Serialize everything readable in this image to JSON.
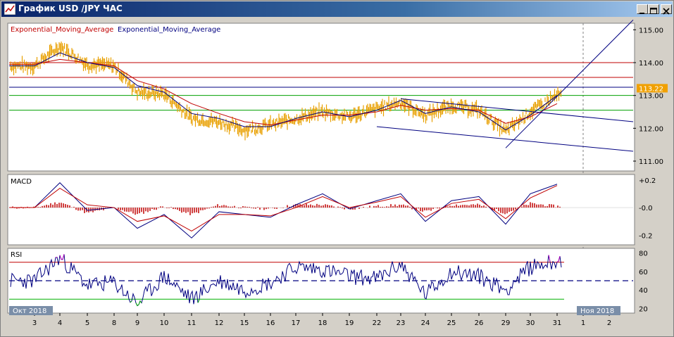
{
  "window": {
    "title": "График USD /JPY  ЧАС",
    "buttons": [
      "minimize",
      "maximize",
      "close"
    ],
    "icons": {
      "app": "chart-icon",
      "minimize": "minimize-icon",
      "maximize": "maximize-icon",
      "close": "close-icon"
    }
  },
  "colors": {
    "background": "#ffffff",
    "frame": "#d4d0c8",
    "price": "#e8a000",
    "ema_red": "#c00000",
    "ema_navy": "#000080",
    "line_level_red": "#c00000",
    "line_level_green": "#00a000",
    "current_price_bg": "#f0a000",
    "macd_hist": "#c00000",
    "rsi_line": "#000080",
    "rsi_overbought": "#c000c0",
    "rsi_oversold": "#00b000"
  },
  "legend": {
    "ema1": "Exponential_Moving_Average",
    "ema2": "Exponential_Moving_Average"
  },
  "price_axis": {
    "ticks": [
      "115.00",
      "114.00",
      "113.00",
      "112.00",
      "111.00"
    ],
    "current": "113.22"
  },
  "macd": {
    "label": "MACD",
    "ticks": [
      "+0.2",
      "-0.0",
      "-0.2"
    ]
  },
  "rsi": {
    "label": "RSI",
    "ticks": [
      "80",
      "60",
      "40",
      "20"
    ]
  },
  "time_axis": {
    "month_left": "Окт 2018",
    "month_right": "Ноя 2018",
    "days": [
      "3",
      "4",
      "5",
      "8",
      "9",
      "10",
      "11",
      "12",
      "15",
      "16",
      "17",
      "18",
      "19",
      "22",
      "23",
      "24",
      "25",
      "26",
      "29",
      "30",
      "31",
      "1",
      "2"
    ]
  },
  "chart_data": {
    "type": "line",
    "title": "График USD /JPY  ЧАС",
    "x": [
      "3",
      "4",
      "5",
      "8",
      "9",
      "10",
      "11",
      "12",
      "15",
      "16",
      "17",
      "18",
      "19",
      "22",
      "23",
      "24",
      "25",
      "26",
      "29",
      "30",
      "31",
      "1",
      "2"
    ],
    "ylim": [
      110.7,
      115.2
    ],
    "series": [
      {
        "name": "USD/JPY",
        "values": [
          113.9,
          114.5,
          113.95,
          113.9,
          113.1,
          113.05,
          112.3,
          112.2,
          111.95,
          112.1,
          112.3,
          112.5,
          112.35,
          112.6,
          112.8,
          112.4,
          112.7,
          112.55,
          111.9,
          112.5,
          113.0,
          null,
          null
        ]
      },
      {
        "name": "Exponential_Moving_Average",
        "values": [
          113.95,
          114.1,
          114.0,
          113.9,
          113.45,
          113.2,
          112.75,
          112.45,
          112.2,
          112.1,
          112.25,
          112.4,
          112.4,
          112.5,
          112.7,
          112.55,
          112.6,
          112.55,
          112.15,
          112.35,
          112.75,
          null,
          null
        ]
      },
      {
        "name": "Exponential_Moving_Average",
        "values": [
          113.9,
          114.3,
          114.0,
          113.85,
          113.3,
          113.1,
          112.45,
          112.3,
          112.05,
          112.05,
          112.3,
          112.5,
          112.35,
          112.55,
          112.85,
          112.45,
          112.65,
          112.5,
          111.95,
          112.4,
          113.0,
          null,
          null
        ]
      }
    ],
    "levels": [
      114.0,
      113.55,
      113.25,
      113.0,
      112.55
    ],
    "trendlines": [
      {
        "from": [
          "29",
          111.4
        ],
        "to": [
          "2",
          115.3
        ]
      },
      {
        "from": [
          "23",
          112.9
        ],
        "to": [
          "2",
          112.2
        ]
      },
      {
        "from": [
          "22",
          112.05
        ],
        "to": [
          "2",
          111.3
        ]
      }
    ],
    "macd": {
      "ylim": [
        -0.27,
        0.24
      ],
      "line": [
        0.0,
        0.18,
        -0.02,
        0.0,
        -0.15,
        -0.05,
        -0.22,
        -0.03,
        -0.05,
        -0.07,
        0.02,
        0.1,
        -0.01,
        0.05,
        0.1,
        -0.1,
        0.05,
        0.08,
        -0.12,
        0.1,
        0.17,
        null,
        null
      ],
      "signal": [
        0.0,
        0.14,
        0.02,
        0.0,
        -0.1,
        -0.06,
        -0.17,
        -0.05,
        -0.05,
        -0.06,
        0.0,
        0.08,
        0.0,
        0.04,
        0.08,
        -0.07,
        0.03,
        0.06,
        -0.08,
        0.07,
        0.16,
        null,
        null
      ],
      "histogram": [
        0.0,
        0.04,
        -0.04,
        0.0,
        -0.05,
        0.01,
        -0.05,
        0.02,
        0.0,
        -0.01,
        0.02,
        0.02,
        -0.01,
        0.01,
        0.02,
        -0.03,
        0.02,
        0.02,
        -0.04,
        0.03,
        0.01,
        null,
        null
      ]
    },
    "rsi": {
      "ylim": [
        15,
        85
      ],
      "levels": [
        70,
        50,
        30
      ],
      "values": [
        50,
        75,
        45,
        48,
        25,
        55,
        30,
        50,
        40,
        48,
        65,
        62,
        55,
        52,
        68,
        35,
        60,
        55,
        40,
        65,
        72,
        null,
        null
      ]
    }
  }
}
